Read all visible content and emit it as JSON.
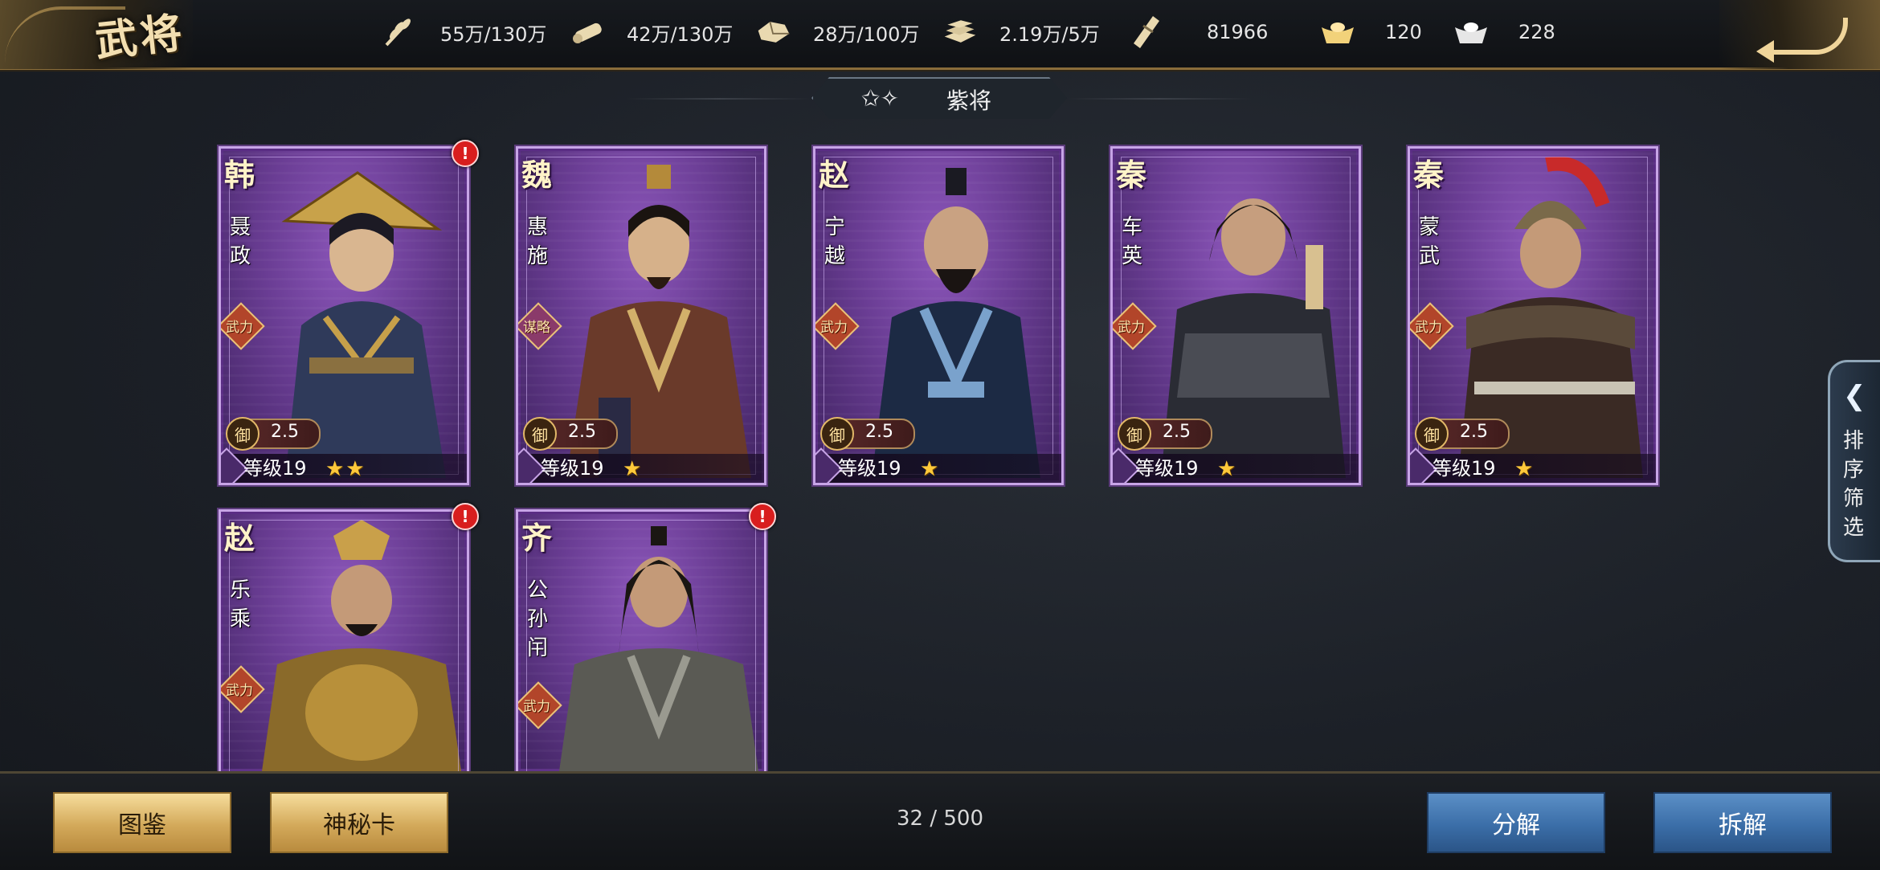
{
  "header": {
    "title": "武将",
    "resources": [
      {
        "icon": "grain-icon",
        "value": "55万/130万"
      },
      {
        "icon": "wood-icon",
        "value": "42万/130万"
      },
      {
        "icon": "stone-icon",
        "value": "28万/100万"
      },
      {
        "icon": "iron-icon",
        "value": "2.19万/5万"
      },
      {
        "icon": "bamboo-slip-icon",
        "value": "81966"
      },
      {
        "icon": "gold-ingot-icon",
        "value": "120"
      },
      {
        "icon": "silver-ingot-icon",
        "value": "228"
      }
    ]
  },
  "section": {
    "label": "紫将"
  },
  "cards": [
    {
      "state": "韩",
      "name": "聂政",
      "type": "武力",
      "cost": "2.5",
      "level": "等级19",
      "stars": "★★",
      "alert": "!"
    },
    {
      "state": "魏",
      "name": "惠施",
      "type": "谋略",
      "cost": "2.5",
      "level": "等级19",
      "stars": "★",
      "alert": ""
    },
    {
      "state": "赵",
      "name": "宁越",
      "type": "武力",
      "cost": "2.5",
      "level": "等级19",
      "stars": "★",
      "alert": ""
    },
    {
      "state": "秦",
      "name": "车英",
      "type": "武力",
      "cost": "2.5",
      "level": "等级19",
      "stars": "★",
      "alert": ""
    },
    {
      "state": "秦",
      "name": "蒙武",
      "type": "武力",
      "cost": "2.5",
      "level": "等级19",
      "stars": "★",
      "alert": ""
    },
    {
      "state": "赵",
      "name": "乐乘",
      "type": "武力",
      "cost": "",
      "level": "",
      "stars": "",
      "alert": "!"
    },
    {
      "state": "齐",
      "name": "公孙闬",
      "type": "武力",
      "cost": "",
      "level": "",
      "stars": "",
      "alert": "!"
    }
  ],
  "cost_prefix": "御",
  "side_tab": {
    "label": "排序筛选"
  },
  "footer": {
    "codex_label": "图鉴",
    "mystery_card_label": "神秘卡",
    "count": "32 / 500",
    "decompose_label": "分解",
    "dismantle_label": "拆解"
  }
}
